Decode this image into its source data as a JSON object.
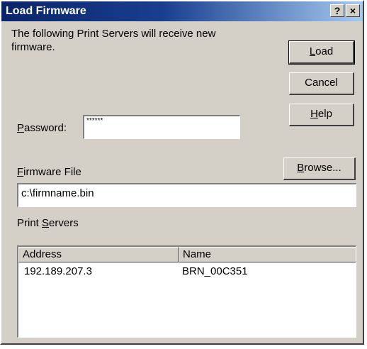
{
  "window": {
    "title": "Load Firmware",
    "help_button": "?",
    "close_button": "×"
  },
  "description": {
    "line1": "The following Print Servers will receive new",
    "line2": "firmware."
  },
  "buttons": {
    "load": {
      "mnemonic": "L",
      "rest": "oad"
    },
    "cancel": "Cancel",
    "help": {
      "mnemonic": "H",
      "rest": "elp"
    },
    "browse": {
      "mnemonic": "B",
      "rest": "rowse..."
    }
  },
  "password": {
    "label_mnemonic": "P",
    "label_rest": "assword:",
    "value": "******"
  },
  "firmware_file": {
    "label_mnemonic": "F",
    "label_rest": "irmware File",
    "value": "c:\\firmname.bin"
  },
  "print_servers": {
    "label_pre": "Print ",
    "label_mnemonic": "S",
    "label_rest": "ervers",
    "columns": [
      "Address",
      "Name"
    ],
    "rows": [
      {
        "address": "192.189.207.3",
        "name": "BRN_00C351"
      }
    ]
  }
}
